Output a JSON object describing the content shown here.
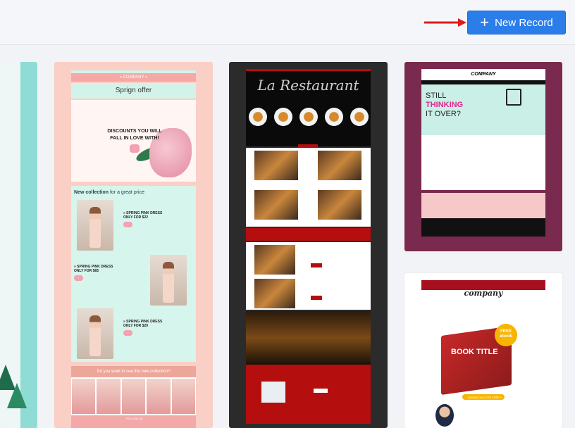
{
  "toolbar": {
    "new_record_label": "New Record",
    "button_color": "#2b7de9"
  },
  "templates": [
    {
      "id": "winter",
      "visible": "partial"
    },
    {
      "id": "spring",
      "company": "« COMPANY »",
      "offer_title": "Sprign offer",
      "hero_text": "DISCOUNTS YOU WILL FALL IN LOVE WITH!",
      "collection_title_bold": "New collection",
      "collection_title_rest": "for a great price",
      "products": [
        {
          "name": "» SPRING PINK DRESS",
          "price": "ONLY FOR $22"
        },
        {
          "name": "» SPRING PINK DRESS",
          "price": "ONLY FOR $65"
        },
        {
          "name": "» SPRING PINK DRESS",
          "price": "ONLY FOR $20"
        }
      ],
      "cta": "Do you want to see the new collection?",
      "follow": "FOLLOW US"
    },
    {
      "id": "restaurant",
      "title": "La Restaurant"
    },
    {
      "id": "company-cart",
      "brand": "COMPANY",
      "line1": "STILL",
      "line2": "THINKING",
      "line3": "IT OVER?",
      "accent": "#e4258c"
    },
    {
      "id": "ebook",
      "brand": "company",
      "book_title": "BOOK TITLE",
      "badge": "FREE ebook",
      "download": "DOWNLOAD FOR FREE »"
    }
  ]
}
